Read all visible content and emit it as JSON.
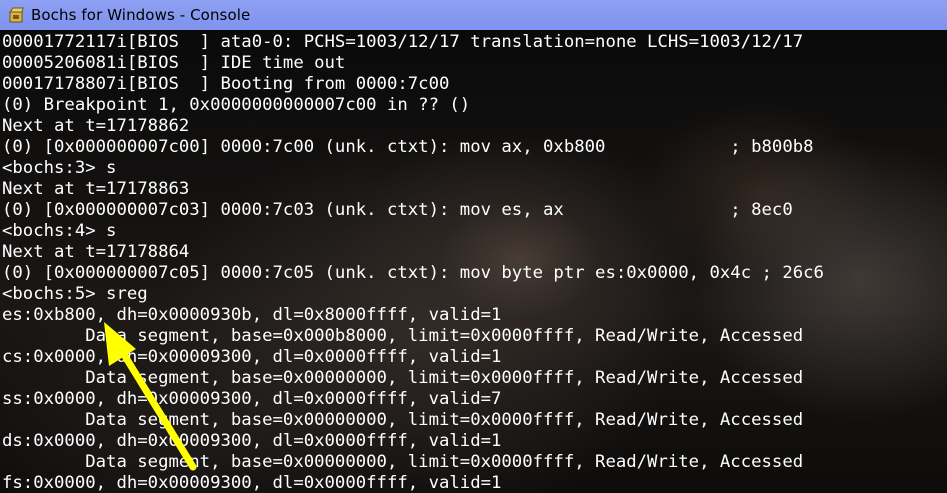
{
  "window": {
    "title": "Bochs for Windows - Console",
    "icon": "bochs-app-icon"
  },
  "console": {
    "lines": [
      "00001772117i[BIOS  ] ata0-0: PCHS=1003/12/17 translation=none LCHS=1003/12/17",
      "00005206081i[BIOS  ] IDE time out",
      "00017178807i[BIOS  ] Booting from 0000:7c00",
      "(0) Breakpoint 1, 0x0000000000007c00 in ?? ()",
      "Next at t=17178862",
      "(0) [0x000000007c00] 0000:7c00 (unk. ctxt): mov ax, 0xb800            ; b800b8",
      "<bochs:3> s",
      "Next at t=17178863",
      "(0) [0x000000007c03] 0000:7c03 (unk. ctxt): mov es, ax                ; 8ec0",
      "<bochs:4> s",
      "Next at t=17178864",
      "(0) [0x000000007c05] 0000:7c05 (unk. ctxt): mov byte ptr es:0x0000, 0x4c ; 26c6",
      "<bochs:5> sreg",
      "es:0xb800, dh=0x0000930b, dl=0x8000ffff, valid=1",
      "        Data segment, base=0x000b8000, limit=0x0000ffff, Read/Write, Accessed",
      "cs:0x0000, dh=0x00009300, dl=0x0000ffff, valid=1",
      "        Data segment, base=0x00000000, limit=0x0000ffff, Read/Write, Accessed",
      "ss:0x0000, dh=0x00009300, dl=0x0000ffff, valid=7",
      "        Data segment, base=0x00000000, limit=0x0000ffff, Read/Write, Accessed",
      "ds:0x0000, dh=0x00009300, dl=0x0000ffff, valid=1",
      "        Data segment, base=0x00000000, limit=0x0000ffff, Read/Write, Accessed",
      "fs:0x0000, dh=0x00009300, dl=0x0000ffff, valid=1"
    ]
  },
  "annotation": {
    "icon": "yellow-arrow-annotation",
    "color": "#ffff00"
  },
  "colors": {
    "titlebar": "#8799f0",
    "console_text": "#ffffff",
    "console_bg": "#000000"
  }
}
